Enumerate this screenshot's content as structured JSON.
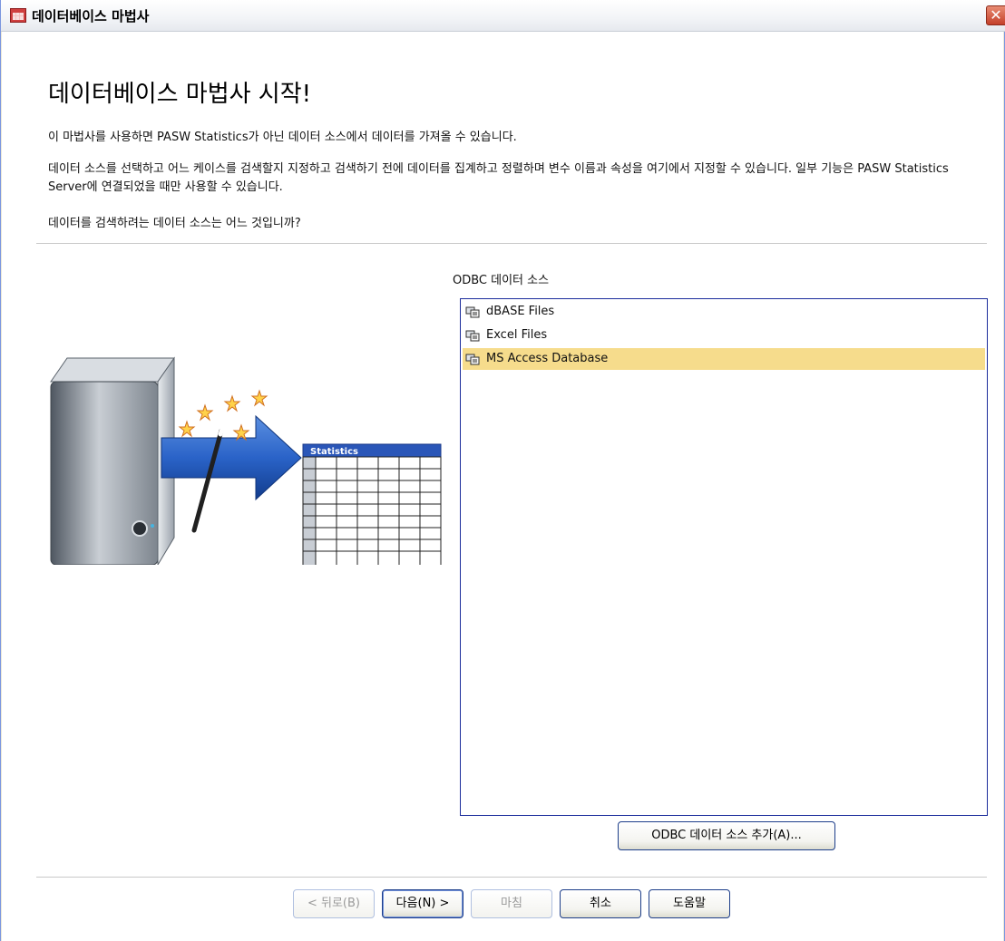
{
  "window": {
    "title": "데이터베이스 마법사",
    "close_label": "✕"
  },
  "intro": {
    "heading": "데이터베이스 마법사 시작!",
    "line1": "이 마법사를 사용하면 PASW Statistics가 아닌 데이터 소스에서 데이터를 가져올 수 있습니다.",
    "line2": "데이터 소스를 선택하고 어느 케이스를 검색할지 지정하고 검색하기 전에 데이터를 집계하고 정렬하며 변수 이름과 속성을 여기에서 지정할 수 있습니다. 일부 기능은 PASW Statistics Server에 연결되었을 때만 사용할 수 있습니다.",
    "question": "데이터를 검색하려는 데이터 소스는 어느 것입니까?"
  },
  "illustration": {
    "sheet_title": "Statistics"
  },
  "odbc": {
    "label": "ODBC 데이터 소스",
    "items": [
      {
        "label": "dBASE Files",
        "selected": false
      },
      {
        "label": "Excel Files",
        "selected": false
      },
      {
        "label": "MS Access Database",
        "selected": true
      }
    ],
    "add_button": "ODBC 데이터 소스 추가(A)..."
  },
  "footer": {
    "back": "< 뒤로(B)",
    "next": "다음(N) >",
    "finish": "마침",
    "cancel": "취소",
    "help": "도움말"
  },
  "colors": {
    "selection": "#f6dc8c",
    "list_border": "#1c2d9c",
    "arrow": "#2a63c8"
  }
}
